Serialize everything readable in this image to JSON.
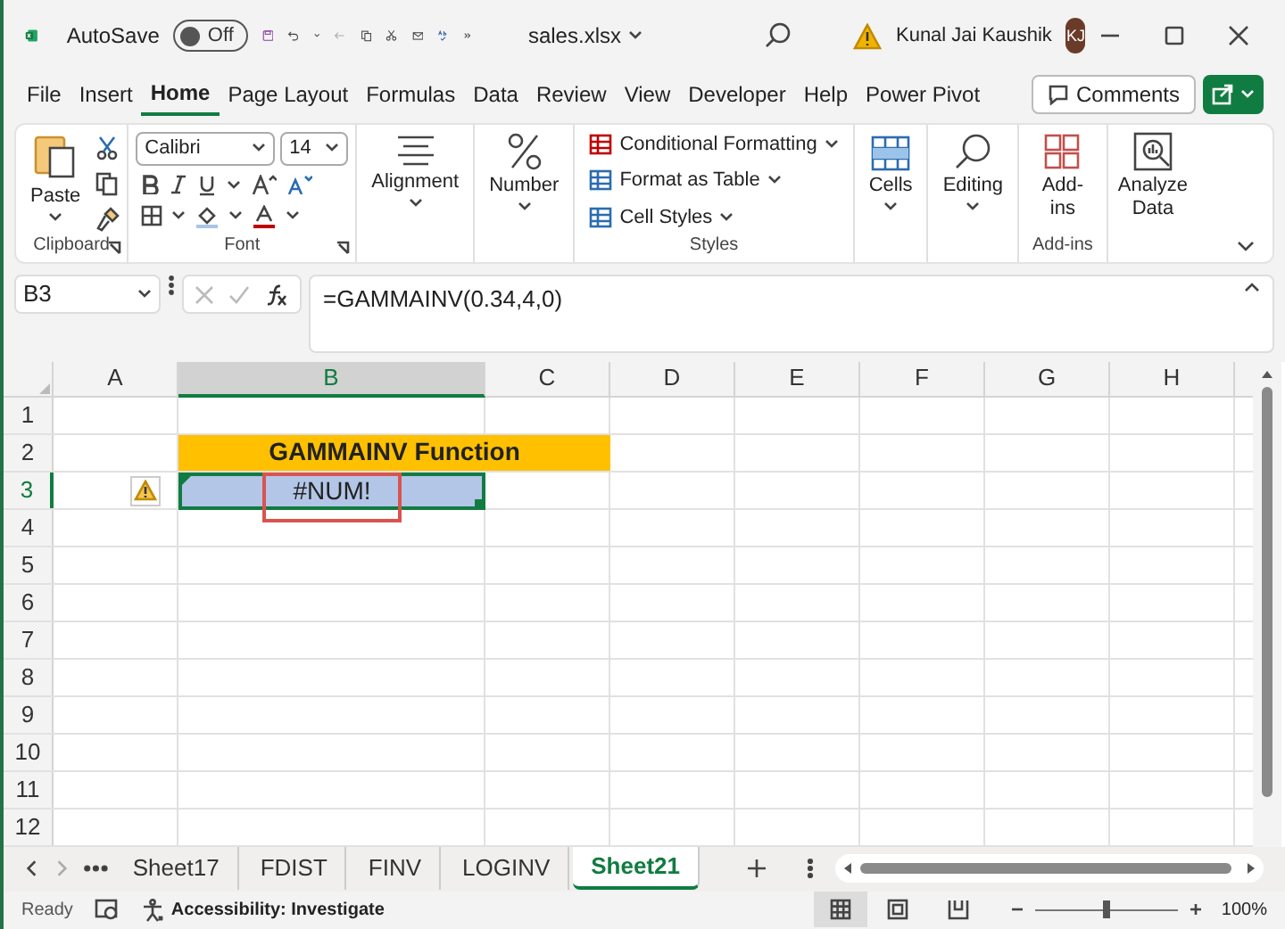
{
  "title_bar": {
    "autosave_label": "AutoSave",
    "autosave_toggle": {
      "label": "Off",
      "on": false
    },
    "file_name": "sales.xlsx",
    "user_name": "Kunal Jai Kaushik",
    "avatar_initials": "KJ"
  },
  "menu_tabs": [
    {
      "label": "File",
      "selected": false
    },
    {
      "label": "Insert",
      "selected": false
    },
    {
      "label": "Home",
      "selected": true
    },
    {
      "label": "Page Layout",
      "selected": false
    },
    {
      "label": "Formulas",
      "selected": false
    },
    {
      "label": "Data",
      "selected": false
    },
    {
      "label": "Review",
      "selected": false
    },
    {
      "label": "View",
      "selected": false
    },
    {
      "label": "Developer",
      "selected": false
    },
    {
      "label": "Help",
      "selected": false
    },
    {
      "label": "Power Pivot",
      "selected": false
    }
  ],
  "comments_button": "Comments",
  "ribbon": {
    "paste": "Paste",
    "clipboard_label": "Clipboard",
    "font_name": "Calibri",
    "font_size": "14",
    "font_label": "Font",
    "alignment": "Alignment",
    "number": "Number",
    "conditional_formatting": "Conditional Formatting",
    "format_as_table": "Format as Table",
    "cell_styles": "Cell Styles",
    "styles_label": "Styles",
    "cells": "Cells",
    "editing": "Editing",
    "add_ins": "Add-ins",
    "add_ins_label": "Add-ins",
    "analyze_data": "Analyze Data"
  },
  "formula_bar": {
    "name_box": "B3",
    "formula": "=GAMMAINV(0.34,4,0)"
  },
  "grid": {
    "columns": [
      {
        "label": "A",
        "selected": false
      },
      {
        "label": "B",
        "selected": true
      },
      {
        "label": "C",
        "selected": false
      },
      {
        "label": "D",
        "selected": false
      },
      {
        "label": "E",
        "selected": false
      },
      {
        "label": "F",
        "selected": false
      },
      {
        "label": "G",
        "selected": false
      },
      {
        "label": "H",
        "selected": false
      }
    ],
    "rows": [
      {
        "label": "1",
        "selected": false,
        "cells": []
      },
      {
        "label": "2",
        "selected": false,
        "cells": [
          {
            "kind": "empty"
          },
          {
            "kind": "title",
            "text": "GAMMAINV Function"
          }
        ]
      },
      {
        "label": "3",
        "selected": true,
        "cells": [
          {
            "kind": "warning"
          },
          {
            "kind": "error",
            "text": "#NUM!",
            "selected": true
          }
        ]
      },
      {
        "label": "4",
        "selected": false,
        "cells": []
      },
      {
        "label": "5",
        "selected": false,
        "cells": []
      },
      {
        "label": "6",
        "selected": false,
        "cells": []
      },
      {
        "label": "7",
        "selected": false,
        "cells": []
      },
      {
        "label": "8",
        "selected": false,
        "cells": []
      },
      {
        "label": "9",
        "selected": false,
        "cells": []
      },
      {
        "label": "10",
        "selected": false,
        "cells": []
      },
      {
        "label": "11",
        "selected": false,
        "cells": []
      },
      {
        "label": "12",
        "selected": false,
        "cells": []
      }
    ]
  },
  "sheet_tabs": [
    {
      "label": "Sheet17",
      "selected": false
    },
    {
      "label": "FDIST",
      "selected": false
    },
    {
      "label": "FINV",
      "selected": false
    },
    {
      "label": "LOGINV",
      "selected": false
    },
    {
      "label": "Sheet21",
      "selected": true
    }
  ],
  "status_bar": {
    "status": "Ready",
    "accessibility": "Accessibility: Investigate",
    "zoom": {
      "level": 0.5
    },
    "zoom_label": "100%"
  }
}
